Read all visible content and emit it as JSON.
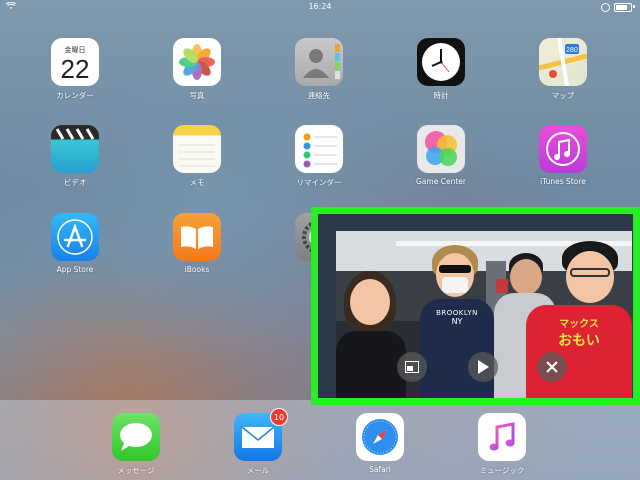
{
  "status": {
    "time": "16:24"
  },
  "apps": {
    "calendar": {
      "label": "カレンダー",
      "weekday": "金曜日",
      "day": "22"
    },
    "photos": {
      "label": "写真"
    },
    "contacts": {
      "label": "連絡先"
    },
    "clock": {
      "label": "時計"
    },
    "maps": {
      "label": "マップ",
      "route": "280"
    },
    "videos": {
      "label": "ビデオ"
    },
    "notes": {
      "label": "メモ"
    },
    "reminders": {
      "label": "リマインダー"
    },
    "gamecenter": {
      "label": "Game Center"
    },
    "itunes": {
      "label": "iTunes Store"
    },
    "appstore": {
      "label": "App Store"
    },
    "ibooks": {
      "label": "iBooks"
    },
    "settings": {
      "label": "設定"
    }
  },
  "dock": {
    "messages": {
      "label": "メッセージ"
    },
    "mail": {
      "label": "メール",
      "badge": "10"
    },
    "safari": {
      "label": "Safari"
    },
    "music": {
      "label": "ミュージック"
    }
  },
  "pip": {
    "shirt_text": "マックス",
    "shirt_text2": "おもい",
    "sweater_text": "BROOKLYN",
    "sweater_text2": "NY"
  },
  "colors": {
    "highlight": "#28ee28",
    "badge": "#f03a2e"
  }
}
